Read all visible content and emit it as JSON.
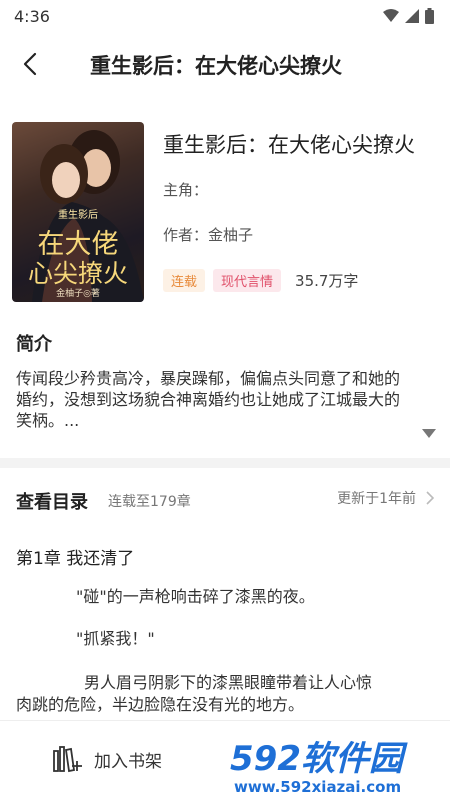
{
  "status_bar": {
    "time": "4:36"
  },
  "header": {
    "title": "重生影后：在大佬心尖撩火"
  },
  "book": {
    "title": "重生影后：在大佬心尖撩火",
    "protagonist_label": "主角：",
    "author_line": "作者：金柚子",
    "tags": [
      "连载",
      "现代言情"
    ],
    "word_count": "35.7万字",
    "cover": {
      "small_title": "重生影后",
      "main_line_1": "在大佬",
      "main_line_2": "心尖撩火",
      "author": "金柚子◎著"
    }
  },
  "intro": {
    "heading": "简介",
    "lines": [
      "传闻段少矜贵高冷，暴戾躁郁，偏偏点头同意了和她的",
      "婚约，没想到这场貌合神离婚约也让她成了江城最大的",
      "笑柄。..."
    ]
  },
  "toc": {
    "title": "查看目录",
    "progress": "连载至179章",
    "updated": "更新于1年前"
  },
  "chapter": {
    "title": "第1章 我还清了",
    "paragraphs": [
      "\"碰\"的一声枪响击碎了漆黑的夜。",
      "\"抓紧我！\"",
      "男人眉弓阴影下的漆黑眼瞳带着让人心惊",
      "肉跳的危险，半边脸隐在没有光的地方。"
    ]
  },
  "bottom_bar": {
    "add_to_shelf": "加入书架"
  },
  "watermark": {
    "brand": "592软件园",
    "url": "www.592xiazai.com"
  },
  "colors": {
    "tag_serial": "#e88a3a",
    "tag_genre": "#e0506a",
    "watermark_blue": "#1e6fd6"
  }
}
